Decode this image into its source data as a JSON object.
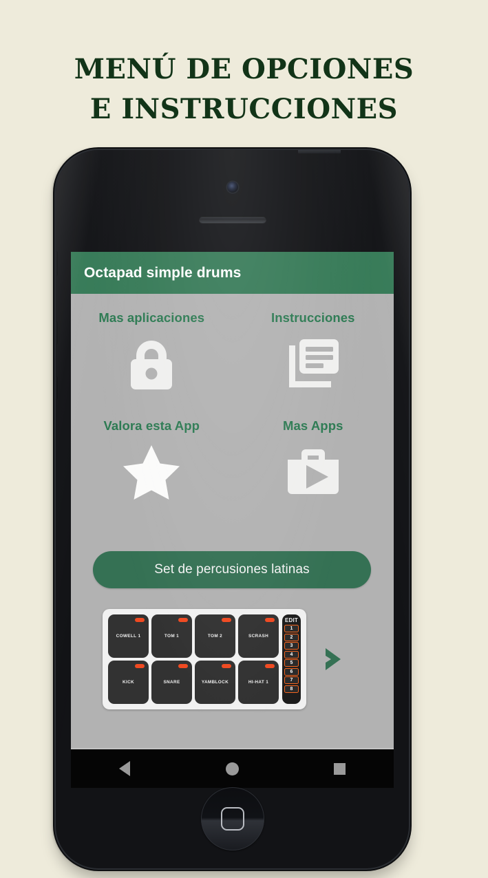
{
  "page": {
    "background_color": "#eeebdb",
    "headline_color": "#123418",
    "headline_lines": [
      "Menú de opciones",
      "e instrucciones"
    ]
  },
  "app": {
    "appbar": {
      "title": "Octapad simple drums",
      "background_color": "#367a57",
      "text_color": "#ffffff"
    },
    "screen_background": "#b2b2b2",
    "accent_green": "#2c7a52",
    "options": [
      {
        "label": "Mas aplicaciones",
        "icon": "lock-icon"
      },
      {
        "label": "Instrucciones",
        "icon": "article-icon"
      },
      {
        "label": "Valora esta App",
        "icon": "star-icon"
      },
      {
        "label": "Mas Apps",
        "icon": "play-store-briefcase-icon"
      }
    ],
    "set_button": {
      "label": "Set de percusiones latinas",
      "background_color": "#357154"
    },
    "preview": {
      "pads": [
        "COWELL 1",
        "TOM 1",
        "TOM 2",
        "SCRASH",
        "KICK",
        "SNARE",
        "YAMBLOCK",
        "HI-HAT 1"
      ],
      "edit_label": "EDIT",
      "edit_numbers": [
        "1",
        "2",
        "3",
        "4",
        "5",
        "6",
        "7",
        "8"
      ],
      "led_color": "#f04a21",
      "edit_border_color": "#f4651f",
      "next_arrow_color": "#357154"
    },
    "navbar": {
      "back": "back-triangle",
      "home": "home-circle",
      "recents": "recents-square"
    }
  },
  "device": {
    "body_color": "#121316",
    "buttons": [
      "silent-switch",
      "volume-up",
      "volume-down",
      "power-button"
    ],
    "front_elements": [
      "front-camera",
      "earpiece-speaker",
      "home-button"
    ]
  }
}
